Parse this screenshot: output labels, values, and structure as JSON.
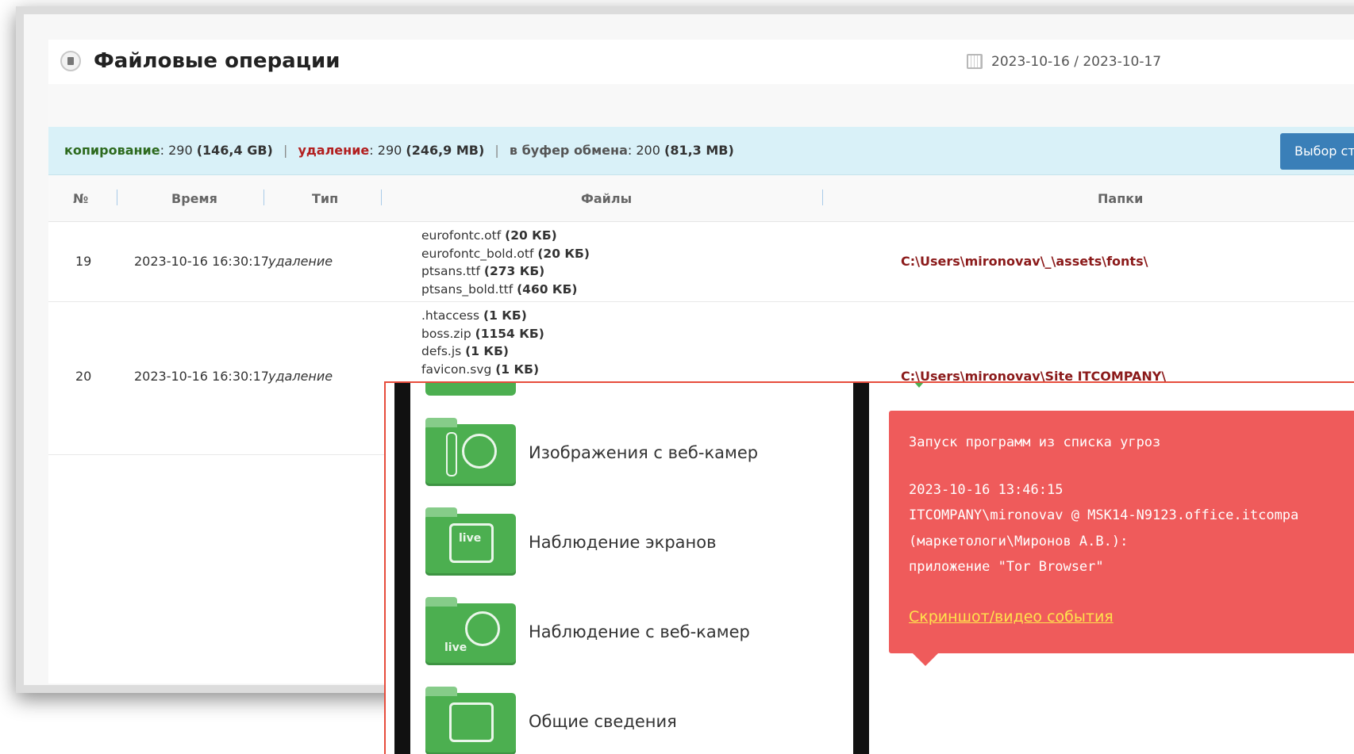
{
  "page": {
    "title": "Файловые операции",
    "date_range": "2023-10-16 / 2023-10-17"
  },
  "summary": {
    "copy_label": "копирование",
    "copy_count": ": 290 ",
    "copy_size": "(146,4 GB)",
    "delete_label": "удаление",
    "delete_count": ": 290 ",
    "delete_size": "(246,9 MB)",
    "buffer_label": "в буфер обмена",
    "buffer_count": ": 200 ",
    "buffer_size": "(81,3 MB)",
    "separator": "|",
    "choose_button": "Выбор ст"
  },
  "table": {
    "headers": [
      "№",
      "Время",
      "Тип",
      "Файлы",
      "Папки"
    ],
    "rows": [
      {
        "num": "19",
        "time": "2023-10-16 16:30:17",
        "type": "удаление",
        "files": [
          {
            "name": "eurofontc.otf ",
            "size": "(20 КБ)"
          },
          {
            "name": "eurofontc_bold.otf ",
            "size": "(20 КБ)"
          },
          {
            "name": "ptsans.ttf ",
            "size": "(273 КБ)"
          },
          {
            "name": "ptsans_bold.ttf ",
            "size": "(460 КБ)"
          }
        ],
        "folder": "C:\\Users\\mironovav\\_\\assets\\fonts\\"
      },
      {
        "num": "20",
        "time": "2023-10-16 16:30:17",
        "type": "удаление",
        "files": [
          {
            "name": ".htaccess ",
            "size": "(1 КБ)"
          },
          {
            "name": "boss.zip ",
            "size": "(1154 КБ)"
          },
          {
            "name": "defs.js ",
            "size": "(1 КБ)"
          },
          {
            "name": "favicon.svg ",
            "size": "(1 КБ)"
          }
        ],
        "folder": "C:\\Users\\mironovav\\Site ITCOMPANY\\"
      }
    ]
  },
  "menu": {
    "items": [
      {
        "label": "Изображения с веб-камер",
        "icon": "webcam-images-icon"
      },
      {
        "label": "Наблюдение экранов",
        "icon": "screen-live-icon",
        "badge": "live"
      },
      {
        "label": "Наблюдение с веб-камер",
        "icon": "webcam-live-icon",
        "badge": "live"
      },
      {
        "label": "Общие сведения",
        "icon": "general-info-icon"
      }
    ]
  },
  "alert": {
    "title": "Запуск программ из списка угроз",
    "timestamp": "2023-10-16 13:46:15",
    "user_line": "ITCOMPANY\\mironovav @ MSK14-N9123.office.itcompa",
    "group_line": "(маркетологи\\Миронов А.В.):",
    "app_line": "приложение \"Tor Browser\"",
    "link": "Скриншот/видео события"
  },
  "colors": {
    "accent_blue": "#3a7fb8",
    "summary_bg": "#d9f1f8",
    "alert_red": "#ef5b5b",
    "menu_green": "#4caf50",
    "folder_red": "#8b1a1a",
    "link_yellow": "#ffe34d"
  }
}
